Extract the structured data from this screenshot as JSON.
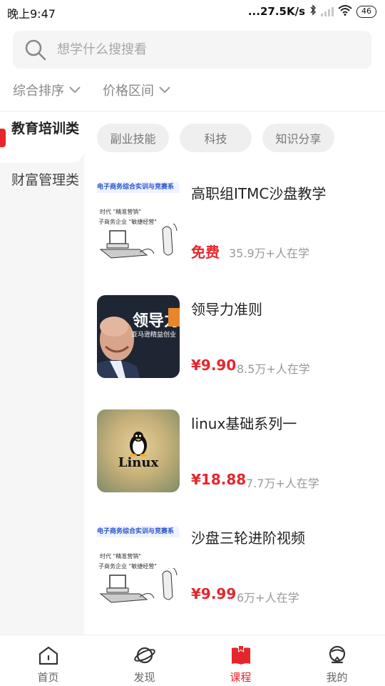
{
  "status_bar": {
    "time": "晚上9:47",
    "network_speed": "...27.5K/s",
    "battery": "46"
  },
  "search": {
    "placeholder": "想学什么搜搜看",
    "icon": "search-icon"
  },
  "filters": [
    {
      "label": "综合排序",
      "icon": "chevron-down-icon"
    },
    {
      "label": "价格区间",
      "icon": "chevron-down-icon"
    }
  ],
  "sidebar": {
    "items": [
      {
        "label": "教育培训类",
        "active": true
      },
      {
        "label": "财富管理类",
        "active": false
      }
    ]
  },
  "tags": [
    {
      "label": "副业技能"
    },
    {
      "label": "科技"
    },
    {
      "label": "知识分享"
    }
  ],
  "courses": [
    {
      "title": "高职组ITMC沙盘教学",
      "price": "免费",
      "learners": "35.9万+人在学",
      "thumb_banner": "电子商务综合实训与竞赛系",
      "thumb_line1": "时代 \"精准营销\"",
      "thumb_line2": "子商务企业 \"敏捷经营\""
    },
    {
      "title": "领导力准则",
      "price": "¥9.90",
      "learners": "8.5万+人在学",
      "thumb_title": "领导力",
      "thumb_subtitle": "亚马逊精益创业"
    },
    {
      "title": "linux基础系列一",
      "price": "¥18.88",
      "learners": "7.7万+人在学",
      "thumb_text": "Linux"
    },
    {
      "title": "沙盘三轮进阶视频",
      "price": "¥9.99",
      "learners": "6万+人在学",
      "thumb_banner": "电子商务综合实训与竞赛系",
      "thumb_line1": "时代 \"精准营销\"",
      "thumb_line2": "子商务企业 \"敏捷经营\""
    }
  ],
  "bottom_nav": [
    {
      "label": "首页",
      "icon": "home-icon",
      "active": false
    },
    {
      "label": "发现",
      "icon": "planet-icon",
      "active": false
    },
    {
      "label": "课程",
      "icon": "book-icon",
      "active": true
    },
    {
      "label": "我的",
      "icon": "profile-icon",
      "active": false
    }
  ],
  "colors": {
    "accent": "#e6262d",
    "muted": "#999999",
    "sidebar_bg": "#f6f6f6"
  }
}
